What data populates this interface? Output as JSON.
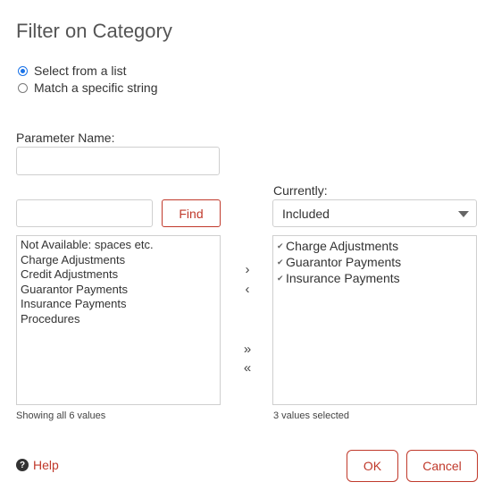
{
  "dialog": {
    "title": "Filter on Category"
  },
  "mode": {
    "options": [
      {
        "label": "Select from a list",
        "checked": true
      },
      {
        "label": "Match a specific string",
        "checked": false
      }
    ]
  },
  "parameter": {
    "label": "Parameter Name:",
    "value": ""
  },
  "search": {
    "value": "",
    "find_label": "Find"
  },
  "currently": {
    "label": "Currently:",
    "selected": "Included"
  },
  "available": {
    "items": [
      "Not Available: spaces etc.",
      "Charge Adjustments",
      "Credit Adjustments",
      "Guarantor Payments",
      "Insurance Payments",
      "Procedures"
    ],
    "status": "Showing all 6 values"
  },
  "selected": {
    "items": [
      "Charge Adjustments",
      "Guarantor Payments",
      "Insurance Payments"
    ],
    "status": "3 values selected"
  },
  "transfer": {
    "add": "›",
    "remove": "‹",
    "add_all": "»",
    "remove_all": "«"
  },
  "footer": {
    "help_label": "Help",
    "ok_label": "OK",
    "cancel_label": "Cancel"
  }
}
